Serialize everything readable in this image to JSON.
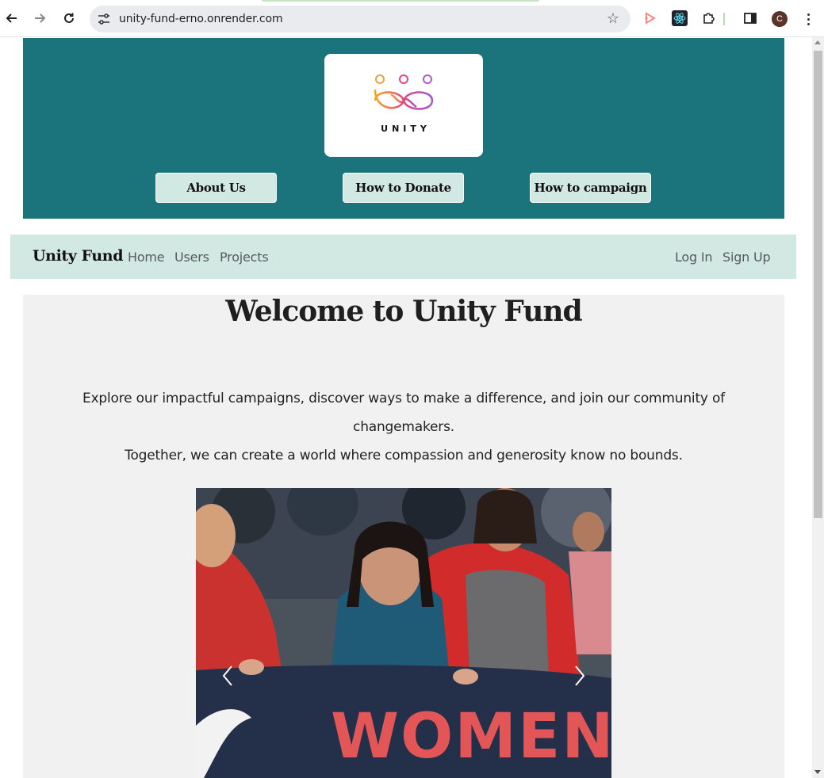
{
  "browser": {
    "url": "unity-fund-erno.onrender.com",
    "profile_initial": "C"
  },
  "hero": {
    "logo_text": "UNITY",
    "buttons": [
      {
        "label": "About Us"
      },
      {
        "label": "How to Donate"
      },
      {
        "label": "How to campaign"
      }
    ],
    "colors": {
      "background": "#1b737c",
      "button": "#d2e8e3"
    }
  },
  "navbar": {
    "brand": "Unity Fund",
    "links": [
      {
        "label": "Home"
      },
      {
        "label": "Users"
      },
      {
        "label": "Projects"
      }
    ],
    "auth": [
      {
        "label": "Log In"
      },
      {
        "label": "Sign Up"
      }
    ]
  },
  "main": {
    "heading": "Welcome to Unity Fund",
    "intro_line1": "Explore our impactful campaigns, discover ways to make a difference, and join our community of changemakers.",
    "intro_line2": "Together, we can create a world where compassion and generosity know no bounds.",
    "carousel": {
      "banner_text": "WOMEN",
      "controls": {
        "prev": "chevron-left-icon",
        "next": "chevron-right-icon"
      }
    }
  }
}
